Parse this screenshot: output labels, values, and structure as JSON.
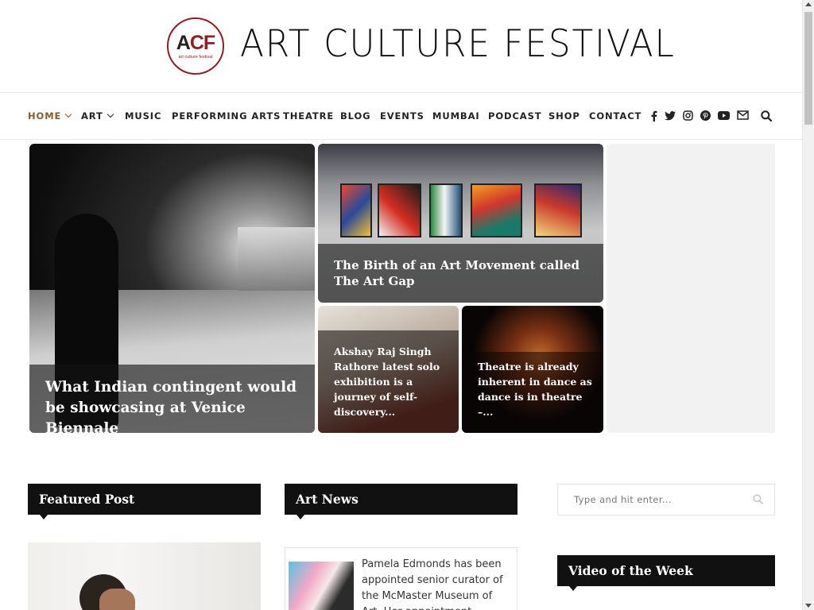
{
  "site": {
    "logo_text": "ACF",
    "logo_sub": "art culture festival",
    "title": "ART CULTURE FESTIVAL"
  },
  "nav": {
    "items": [
      {
        "label": "HOME",
        "active": true,
        "dropdown": true
      },
      {
        "label": "ART",
        "active": false,
        "dropdown": true
      },
      {
        "label": "MUSIC",
        "active": false,
        "dropdown": false
      },
      {
        "label": "PERFORMING ARTS",
        "active": false,
        "dropdown": false
      },
      {
        "label": "THEATRE",
        "active": false,
        "dropdown": false
      },
      {
        "label": "BLOG",
        "active": false,
        "dropdown": false
      },
      {
        "label": "EVENTS",
        "active": false,
        "dropdown": false
      },
      {
        "label": "MUMBAI",
        "active": false,
        "dropdown": false
      },
      {
        "label": "PODCAST",
        "active": false,
        "dropdown": false
      },
      {
        "label": "SHOP",
        "active": false,
        "dropdown": false
      },
      {
        "label": "CONTACT",
        "active": false,
        "dropdown": false
      }
    ],
    "social_icons": [
      "facebook-icon",
      "twitter-icon",
      "instagram-icon",
      "pinterest-icon",
      "youtube-icon",
      "mail-icon"
    ],
    "search_icon": "search-icon",
    "active_color": "#8a5a2b"
  },
  "hero": {
    "big": {
      "caption": "What Indian contingent would be showcasing at Venice Biennale"
    },
    "gallery": {
      "caption": "The Birth of an Art Movement called The Art Gap"
    },
    "akshay": {
      "caption": "Akshay Raj Singh Rathore latest solo exhibition is a journey of self-discovery..."
    },
    "dance": {
      "caption": "Theatre is already inherent in dance as dance is in theatre –..."
    }
  },
  "sections": {
    "featured": "Featured Post",
    "art_news": "Art News",
    "video": "Video of the Week"
  },
  "search": {
    "placeholder": "Type and hit enter..."
  },
  "news": {
    "excerpt": "Pamela Edmonds has been appointed senior curator of the McMaster Museum of Art. Her appointment..."
  }
}
